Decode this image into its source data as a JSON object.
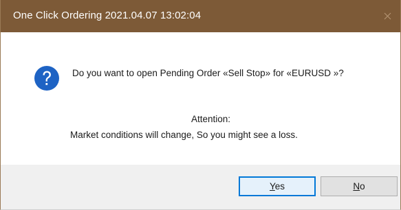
{
  "window": {
    "title": "One Click Ordering 2021.04.07 13:02:04",
    "close_icon": "close-icon",
    "titlebar_color": "#7d5a37"
  },
  "message": {
    "icon": "question-icon",
    "icon_color": "#1e63c4",
    "prompt": "Do you want to open Pending Order «Sell Stop» for «EURUSD »?",
    "attention_title": "Attention:",
    "attention_text": "Market conditions will change, So you might see a loss."
  },
  "buttons": {
    "yes_label": "Yes",
    "no_label": "No",
    "default_border_color": "#0078d7"
  }
}
